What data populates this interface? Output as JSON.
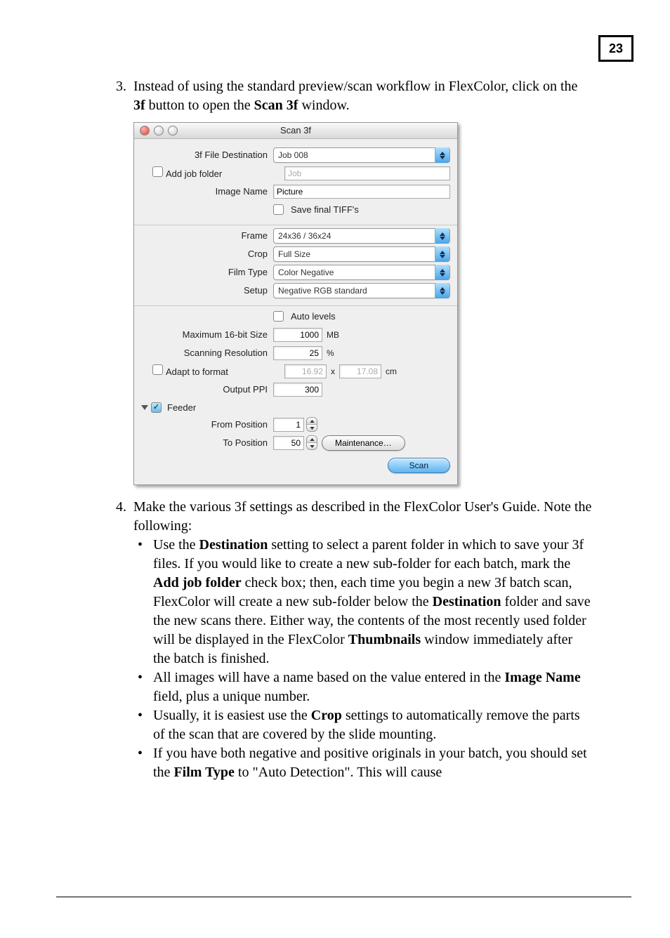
{
  "page_number": "23",
  "step3": {
    "num": "3.",
    "text_before_3f": "Instead of using the standard preview/scan workflow in FlexColor, click on the ",
    "bold_3f": "3f",
    "mid": " button to open the ",
    "bold_scan3f": "Scan 3f",
    "after": " window."
  },
  "window": {
    "title": "Scan 3f",
    "labels": {
      "destination": "3f File Destination",
      "add_job_folder": "Add job folder",
      "image_name": "Image Name",
      "save_final": "Save final TIFF's",
      "frame": "Frame",
      "crop": "Crop",
      "film_type": "Film Type",
      "setup": "Setup",
      "auto_levels": "Auto levels",
      "max_size": "Maximum 16-bit Size",
      "scan_res": "Scanning Resolution",
      "adapt": "Adapt to format",
      "output_ppi": "Output PPI",
      "feeder": "Feeder",
      "from_pos": "From Position",
      "to_pos": "To Position"
    },
    "values": {
      "destination": "Job 008",
      "job_placeholder": "Job",
      "image_name": "Picture",
      "frame": "24x36 / 36x24",
      "crop": "Full Size",
      "film_type": "Color Negative",
      "setup": "Negative RGB standard",
      "max_size": "1000",
      "max_size_unit": "MB",
      "scan_res": "25",
      "scan_res_unit": "%",
      "adapt_w": "16.92",
      "adapt_x": "x",
      "adapt_h": "17.08",
      "adapt_unit": "cm",
      "output_ppi": "300",
      "from_pos": "1",
      "to_pos": "50"
    },
    "buttons": {
      "maintenance": "Maintenance…",
      "scan": "Scan"
    }
  },
  "step4": {
    "num": "4.",
    "intro": "Make the various 3f settings as described in the FlexColor User's Guide. Note the following:",
    "b1": {
      "a": "Use the ",
      "b1": "Destination",
      "c": " setting to select a parent folder in which to save your 3f files. If you would like to create a new sub-folder for each batch, mark the ",
      "b2": "Add job folder",
      "d": " check box; then, each time you begin a new 3f batch scan, FlexColor will create a new sub-folder below the ",
      "b3": "Destination",
      "e": " folder and save the new scans there. Either way, the contents of the most recently used folder will be displayed in the FlexColor ",
      "b4": "Thumbnails",
      "f": " window immediately after the batch is finished."
    },
    "b2": {
      "a": "All images will have a name based on the value entered in the ",
      "b1": "Image Name",
      "c": " field, plus a unique number."
    },
    "b3": {
      "a": "Usually, it is easiest use the ",
      "b1": "Crop",
      "c": " settings to automatically remove the parts of the scan that are covered by the slide mounting."
    },
    "b4": {
      "a": "If you have both negative and positive originals in your batch, you should set the ",
      "b1": "Film Type",
      "c": " to \"Auto Detection\". This will cause"
    }
  }
}
